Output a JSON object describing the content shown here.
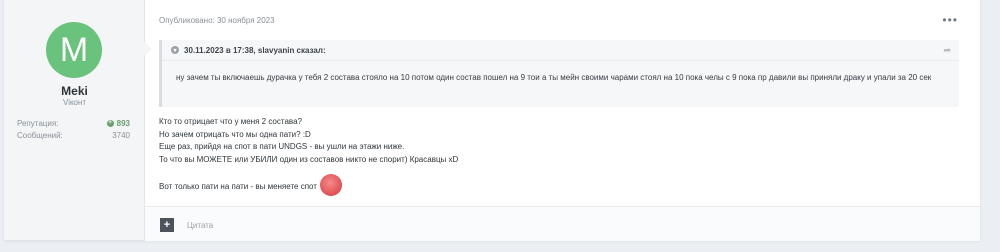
{
  "author": {
    "avatar_letter": "M",
    "avatar_color": "#69c37d",
    "name": "Meki",
    "group": "Viкoнт",
    "stats": [
      {
        "label": "Репутация:",
        "value": "893"
      },
      {
        "label": "Сообщений:",
        "value": "3740"
      }
    ]
  },
  "post": {
    "date": "Опубликовано: 30 ноября 2023",
    "options_icon": "ellipsis-icon",
    "quote": {
      "header": "30.11.2023 в 17:38, slavyanin сказал:",
      "text": "ну зачем ты включаешь дурачка у тебя 2 состава стояло на 10 потом один состав пошел на 9 тои а ты мейн своими чарами стоял на 10 пока челы с 9 пока  пр давили вы приняли драку и упали за 20 сек"
    },
    "lines": [
      "Кто то отрицает что у меня 2 состава?",
      "Но зачем отрицать что мы одна пати? :D",
      "Еще раз, прийдя на спот в пати UNDGS - вы ушли на этажи ниже.",
      "То что вы МОЖЕТЕ или УБИЛИ один из составов никто не спорит) Красавцы xD"
    ],
    "last_line": "Вот только пати на пати - вы меняете спот",
    "emoji": "pig-emoji"
  },
  "footer": {
    "quote_button_symbol": "+",
    "quote_label": "Цитата"
  }
}
